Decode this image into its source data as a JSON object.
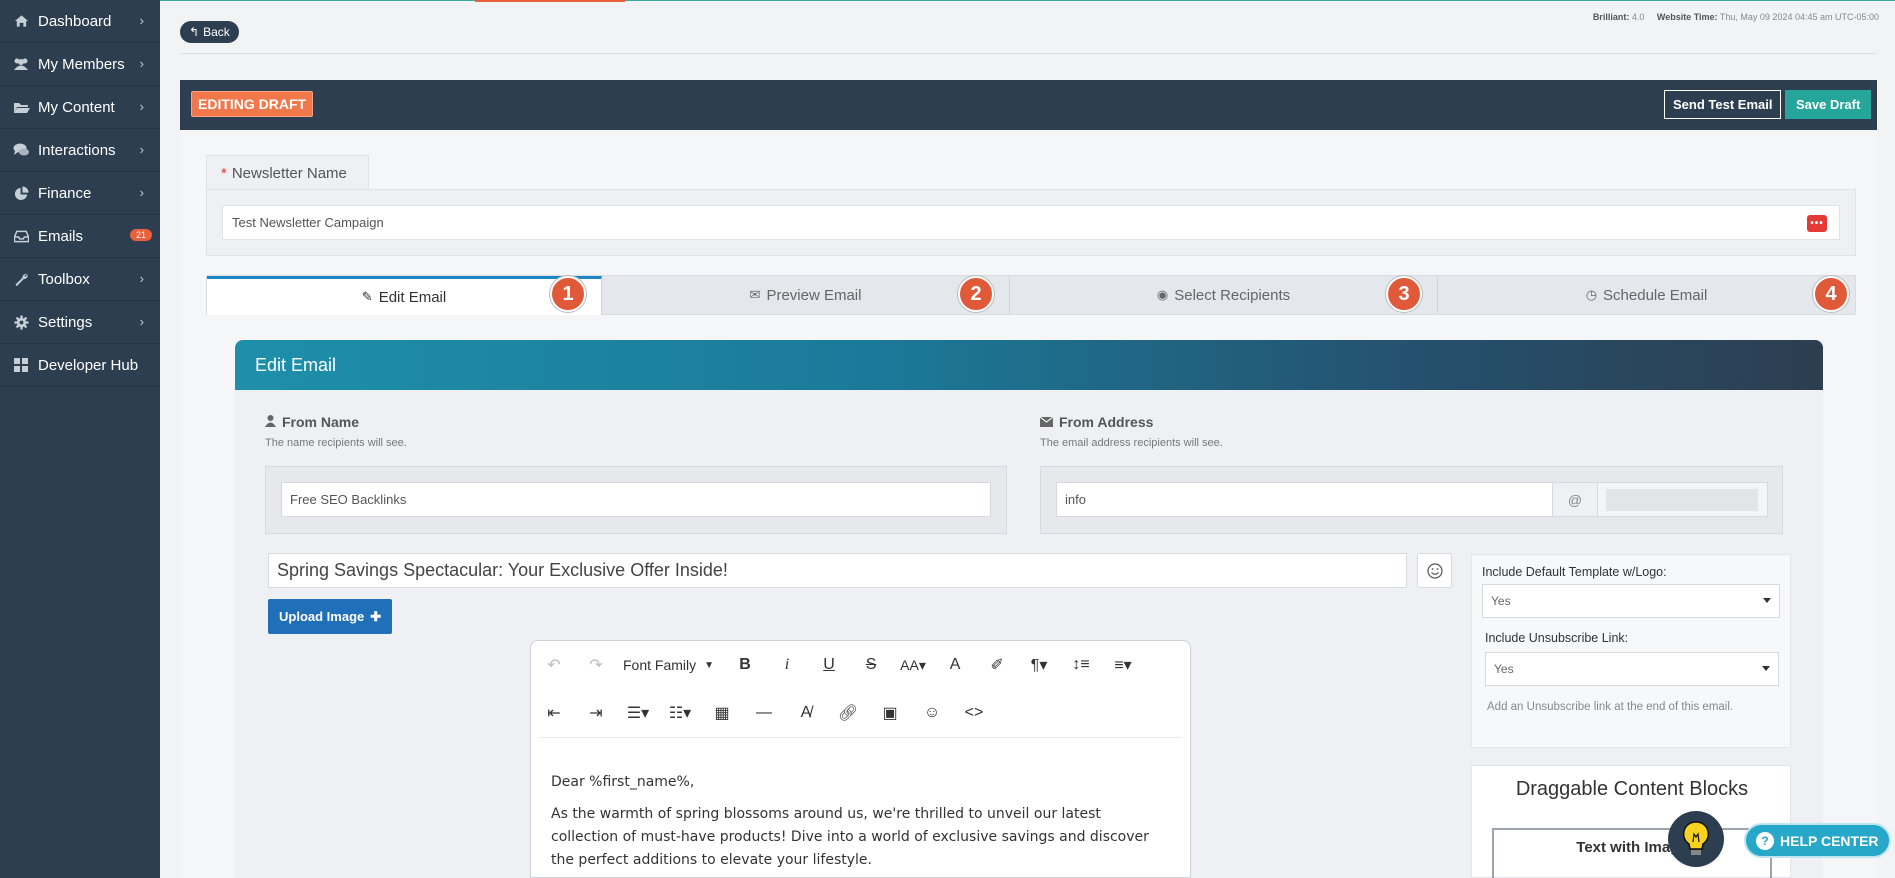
{
  "sidebar": {
    "items": [
      {
        "label": "Dashboard",
        "icon": "home-icon"
      },
      {
        "label": "My Members",
        "icon": "users-icon"
      },
      {
        "label": "My Content",
        "icon": "folder-icon"
      },
      {
        "label": "Interactions",
        "icon": "comments-icon"
      },
      {
        "label": "Finance",
        "icon": "pie-chart-icon"
      },
      {
        "label": "Emails",
        "icon": "inbox-icon",
        "badge": "21"
      },
      {
        "label": "Toolbox",
        "icon": "wrench-icon"
      },
      {
        "label": "Settings",
        "icon": "gear-icon"
      },
      {
        "label": "Developer Hub",
        "icon": "grid-icon"
      }
    ]
  },
  "top": {
    "back_label": "Back",
    "version_label": "Brilliant:",
    "version_value": "4.0",
    "time_label": "Website Time:",
    "time_value": "Thu, May 09 2024 04:45 am UTC-05:00"
  },
  "editor_bar": {
    "status": "EDITING DRAFT",
    "send_test_label": "Send Test Email",
    "save_label": "Save Draft"
  },
  "newsletter": {
    "required_mark": "*",
    "label": "Newsletter Name",
    "value": "Test Newsletter Campaign",
    "dots": "•••"
  },
  "steps": [
    {
      "label": "Edit Email",
      "num": "1",
      "icon": "edit-icon"
    },
    {
      "label": "Preview Email",
      "num": "2",
      "icon": "envelope-open-icon"
    },
    {
      "label": "Select Recipients",
      "num": "3",
      "icon": "user-circle-icon"
    },
    {
      "label": "Schedule Email",
      "num": "4",
      "icon": "clock-icon"
    }
  ],
  "edit_panel": {
    "title": "Edit Email",
    "from_name_label": "From Name",
    "from_name_help": "The name recipients will see.",
    "from_name_value": "Free SEO Backlinks",
    "from_address_label": "From Address",
    "from_address_help": "The email address recipients will see.",
    "from_address_value": "info",
    "at": "@",
    "subject": "Spring Savings Spectacular: Your Exclusive Offer Inside!",
    "upload_label": "Upload Image",
    "font_family_label": "Font Family",
    "body": [
      "Dear %first_name%,",
      "As the warmth of spring blossoms around us, we're thrilled to unveil our latest collection of must-have products! Dive into a world of exclusive savings and discover the perfect additions to elevate your lifestyle."
    ]
  },
  "options": {
    "template_label": "Include Default Template w/Logo:",
    "template_value": "Yes",
    "unsub_label": "Include Unsubscribe Link:",
    "unsub_value": "Yes",
    "unsub_help": "Add an Unsubscribe link at the end of this email."
  },
  "blocks": {
    "title": "Draggable Content Blocks",
    "first_block": "Text with Image"
  },
  "help": {
    "label": "HELP CENTER"
  }
}
